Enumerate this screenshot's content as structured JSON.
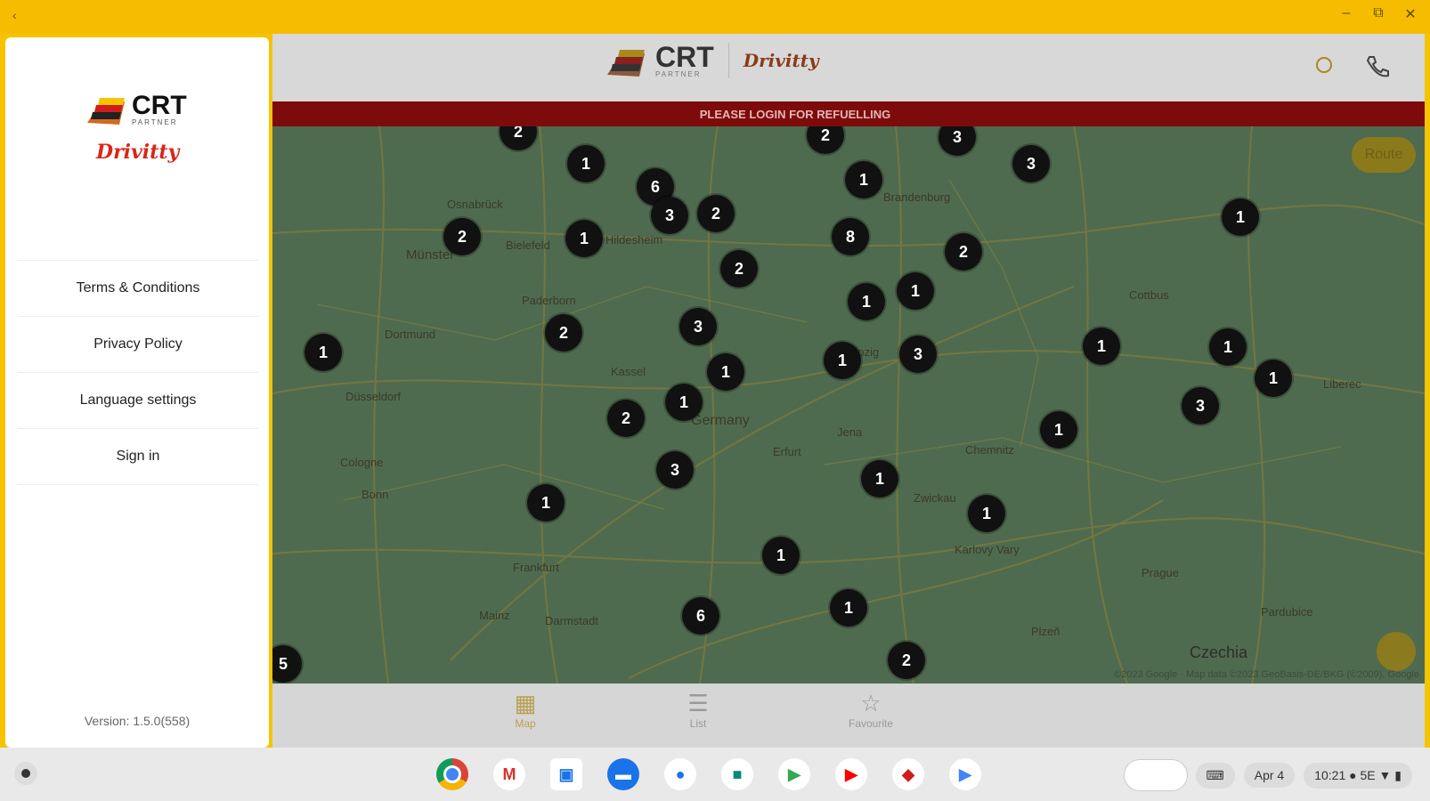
{
  "window": {
    "back_glyph": "‹",
    "minimize": "–",
    "restore": "⧉",
    "close": "✕"
  },
  "drawer": {
    "logo_primary": "CRT",
    "logo_sub": "PARTNER",
    "brand": "Drivitty",
    "menu": [
      {
        "label": "Terms & Conditions"
      },
      {
        "label": "Privacy Policy"
      },
      {
        "label": "Language settings"
      },
      {
        "label": "Sign in"
      }
    ],
    "version": "Version: 1.5.0(558)"
  },
  "header": {
    "logo_primary": "CRT",
    "logo_sub": "PARTNER",
    "brand": "Drivitty",
    "search_icon": "search-icon",
    "phone_icon": "phone-icon"
  },
  "banner": {
    "text": "PLEASE LOGIN FOR REFUELLING"
  },
  "map": {
    "route_label": "Route",
    "country_label": "Czechia",
    "germany_label": "Germany",
    "attribution": "©2023 Google · Map data ©2023 GeoBasis-DE/BKG (©2009), Google",
    "cities": [
      "Osnabrück",
      "Münster",
      "Bielefeld",
      "Paderborn",
      "Dortmund",
      "Düsseldorf",
      "Cologne",
      "Bonn",
      "Kassel",
      "Erfurt",
      "Jena",
      "Chemnitz",
      "Zwickau",
      "Frankfurt",
      "Mainz",
      "Darmstadt",
      "Brandenburg",
      "Prague",
      "Liberec",
      "Pardubice",
      "Karlovy Vary",
      "Plzeň",
      "Hildesheim",
      "Leipzig",
      "Cottbus"
    ],
    "clusters": [
      "2",
      "1",
      "6",
      "3",
      "2",
      "2",
      "1",
      "1",
      "2",
      "3",
      "3",
      "1",
      "8",
      "2",
      "2",
      "1",
      "1",
      "3",
      "1",
      "2",
      "1",
      "1",
      "3",
      "1",
      "2",
      "1",
      "3",
      "1",
      "1",
      "3",
      "1",
      "1",
      "1",
      "6",
      "1",
      "1",
      "2",
      "5",
      "1"
    ]
  },
  "nav": {
    "items": [
      {
        "label": "Map"
      },
      {
        "label": "List"
      },
      {
        "label": "Favourite"
      }
    ]
  },
  "taskbar": {
    "date": "Apr 4",
    "time": "10:21",
    "battery": "5E"
  }
}
